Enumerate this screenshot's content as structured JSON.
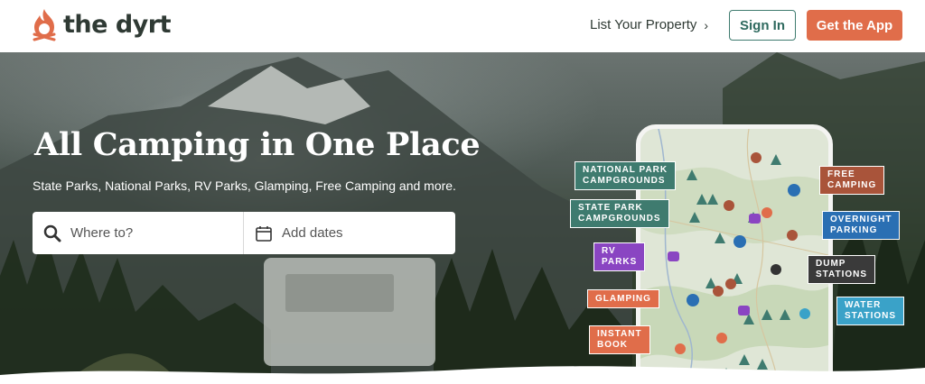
{
  "header": {
    "logo_text": "the dyrt",
    "list_property": "List Your Property",
    "sign_in": "Sign In",
    "get_app": "Get the App"
  },
  "hero": {
    "headline": "All Camping in One Place",
    "subline": "State Parks, National Parks, RV Parks, Glamping, Free Camping and more.",
    "search": {
      "where_placeholder": "Where to?",
      "dates_label": "Add dates"
    }
  },
  "map_labels": {
    "national_park_1": "NATIONAL PARK",
    "national_park_2": "CAMPGROUNDS",
    "state_park_1": "STATE PARK",
    "state_park_2": "CAMPGROUNDS",
    "rv_1": "RV",
    "rv_2": "PARKS",
    "glamping": "GLAMPING",
    "instant_1": "INSTANT",
    "instant_2": "BOOK",
    "free_1": "FREE",
    "free_2": "CAMPING",
    "overnight_1": "OVERNIGHT",
    "overnight_2": "PARKING",
    "dump_1": "DUMP",
    "dump_2": "STATIONS",
    "water_1": "WATER",
    "water_2": "STATIONS"
  },
  "colors": {
    "brand_orange": "#e06d4a",
    "brand_green": "#3f7b6f",
    "free_camping": "#a9543a",
    "overnight_parking": "#2a6fb3",
    "rv_parks": "#8a45c2",
    "dump_stations": "#3a3a3a",
    "water_stations": "#3aa2c8"
  },
  "icons": {
    "logo": "campfire-icon",
    "chevron": "chevron-right-icon",
    "search": "search-icon",
    "calendar": "calendar-icon"
  }
}
